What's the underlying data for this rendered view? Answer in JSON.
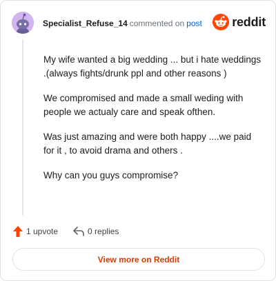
{
  "header": {
    "username": "Specialist_Refuse_14",
    "action_text": "commented on",
    "post_link_label": "post",
    "brand_name": "reddit"
  },
  "comment": {
    "paragraphs": [
      "My wife wanted a big wedding ... but i hate weddings .(always fights/drunk ppl and other reasons )",
      "We compromised and made a small weding with people we actualy care and speak ofthen.",
      "Was just amazing and were both happy ....we paid for it , to avoid drama and others .",
      "Why can you guys compromise?"
    ]
  },
  "actions": {
    "upvote_label": "1 upvote",
    "replies_label": "0 replies",
    "upvote_icon": "upvote-arrow-icon",
    "replies_icon": "reply-arrow-icon"
  },
  "footer": {
    "view_more_label": "View more on Reddit"
  },
  "colors": {
    "brand_orange": "#ff4500",
    "link_blue": "#0a5fd6",
    "view_more_text": "#d93a00",
    "avatar_bg": "#d2b4f0"
  }
}
